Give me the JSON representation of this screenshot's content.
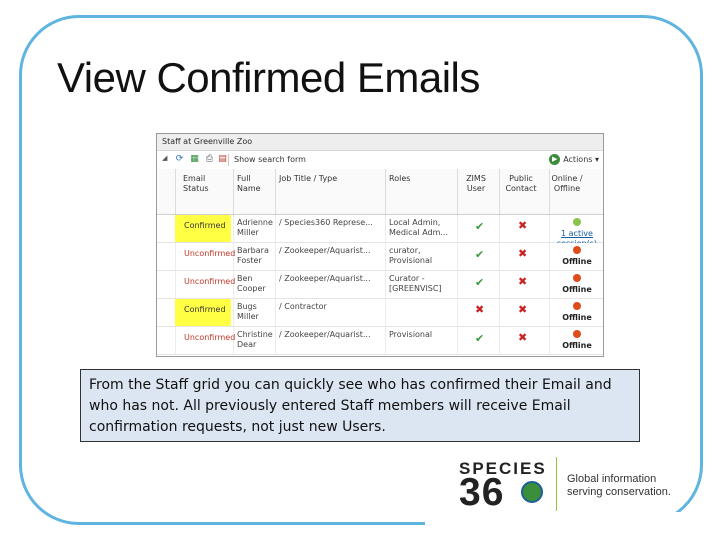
{
  "slide": {
    "title": "View Confirmed Emails"
  },
  "app": {
    "title": "Staff at Greenville Zoo",
    "toolbar": {
      "show_search": "Show search form",
      "actions": "Actions"
    },
    "columns": [
      "Email Status",
      "Full Name",
      "Job Title / Type",
      "Roles",
      "ZIMS User",
      "Public Contact",
      "Online / Offline"
    ],
    "rows": [
      {
        "status": "Confirmed",
        "name": "Adrienne Miller",
        "job": "/ Species360 Represe...",
        "roles": "Local Admin, Medical Adm...",
        "zims": "check",
        "public": "x",
        "online": {
          "state": "online",
          "label": "1 active session(s)"
        }
      },
      {
        "status": "Unconfirmed",
        "name": "Barbara Foster",
        "job": "/ Zookeeper/Aquarist...",
        "roles": "curator, Provisional",
        "zims": "check",
        "public": "x",
        "online": {
          "state": "offline",
          "label": "Offline"
        }
      },
      {
        "status": "Unconfirmed",
        "name": "Ben Cooper",
        "job": "/ Zookeeper/Aquarist...",
        "roles": "Curator - [GREENVISC]",
        "zims": "check",
        "public": "x",
        "online": {
          "state": "offline",
          "label": "Offline"
        }
      },
      {
        "status": "Confirmed",
        "name": "Bugs Miller",
        "job": "/ Contractor",
        "roles": "",
        "zims": "x",
        "public": "x",
        "online": {
          "state": "offline",
          "label": "Offline"
        }
      },
      {
        "status": "Unconfirmed",
        "name": "Christine Dear",
        "job": "/ Zookeeper/Aquarist...",
        "roles": "Provisional",
        "zims": "check",
        "public": "x",
        "online": {
          "state": "offline",
          "label": "Offline"
        }
      }
    ]
  },
  "caption": "From the Staff grid you can quickly see who has confirmed their Email and who has not. All previously entered Staff members will receive Email confirmation requests, not just new Users.",
  "logo": {
    "line1": "SPECIES",
    "line2": "36",
    "tagline_1": "Global information",
    "tagline_2": "serving conservation."
  },
  "colors": {
    "frame": "#5fb4e0",
    "confirmed_highlight": "#ffff44",
    "unconfirmed_text": "#c0392b",
    "caption_bg": "#dce6f2"
  }
}
